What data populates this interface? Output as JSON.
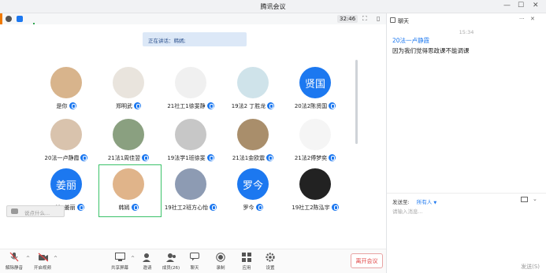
{
  "window": {
    "title": "腾讯会议"
  },
  "toolbar": {
    "timer": "32:46"
  },
  "speaking": {
    "text": "正在讲话：韩嫣;"
  },
  "participants": [
    {
      "name": "是你"
    },
    {
      "name": "郑明武"
    },
    {
      "name": "21社工1徐斐静"
    },
    {
      "name": "19法2 丁胜龙"
    },
    {
      "name": "20法2陈贤国",
      "avatar_text": "贤国"
    },
    {
      "name": "20法一卢静霞"
    },
    {
      "name": "21法1周佳翌"
    },
    {
      "name": "19法学1班徐斐"
    },
    {
      "name": "21法1金欧震"
    },
    {
      "name": "21法2傅梦奕"
    },
    {
      "name": "20社1姜丽",
      "avatar_text": "姜丽"
    },
    {
      "name": "韩嫣"
    },
    {
      "name": "19社工2班方心怡"
    },
    {
      "name": "罗今",
      "avatar_text": "罗今"
    },
    {
      "name": "19社工2陈泓宇"
    }
  ],
  "chat_input_overlay": {
    "placeholder": "说点什么..."
  },
  "bottom": {
    "mute": "解除静音",
    "video": "开启视频",
    "share": "共享屏幕",
    "invite": "邀请",
    "members": "成员(26)",
    "chat": "聊天",
    "record": "录制",
    "apps": "应用",
    "settings": "设置",
    "leave": "离开会议"
  },
  "chat": {
    "title": "聊天",
    "time": "15:34",
    "sender": "20法一卢静霞",
    "message": "因为我们觉得思政课不能调课",
    "send_to_label": "发送至:",
    "send_to_value": "所有人",
    "input_placeholder": "请输入消息...",
    "send": "发送(S)"
  },
  "colors": {
    "accent": "#1c78f0",
    "leave": "#e04444",
    "active_frame": "#3bc26a"
  }
}
